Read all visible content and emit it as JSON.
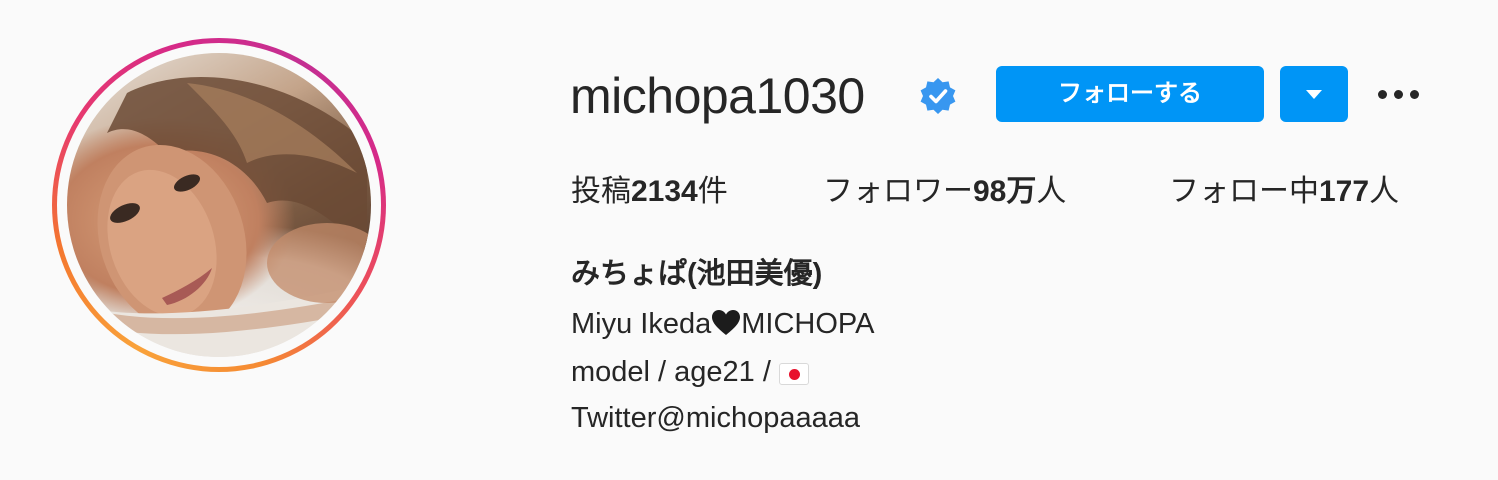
{
  "profile": {
    "username": "michopa1030",
    "verified_icon": "verified-badge-icon",
    "avatar_icon": "profile-photo"
  },
  "actions": {
    "follow_label": "フォローする",
    "dropdown_icon": "caret-down-icon",
    "more_icon": "more-options-icon"
  },
  "stats": {
    "posts_prefix": "投稿",
    "posts_count": "2134",
    "posts_suffix": "件",
    "followers_prefix": "フォロワー",
    "followers_count": "98万",
    "followers_suffix": "人",
    "following_prefix": "フォロー中",
    "following_count": "177",
    "following_suffix": "人"
  },
  "bio": {
    "full_name": "みちょぱ(池田美優)",
    "line1_before": "Miyu Ikeda",
    "line1_after": "MICHOPA",
    "line2": "model / age21 / ",
    "line3": "Twitter@michopaaaaa",
    "heart_icon": "black-heart-icon",
    "flag_icon": "japan-flag-icon"
  },
  "colors": {
    "accent": "#0095f6",
    "verified": "#3897f0",
    "text": "#262626",
    "background": "#fafafa"
  }
}
